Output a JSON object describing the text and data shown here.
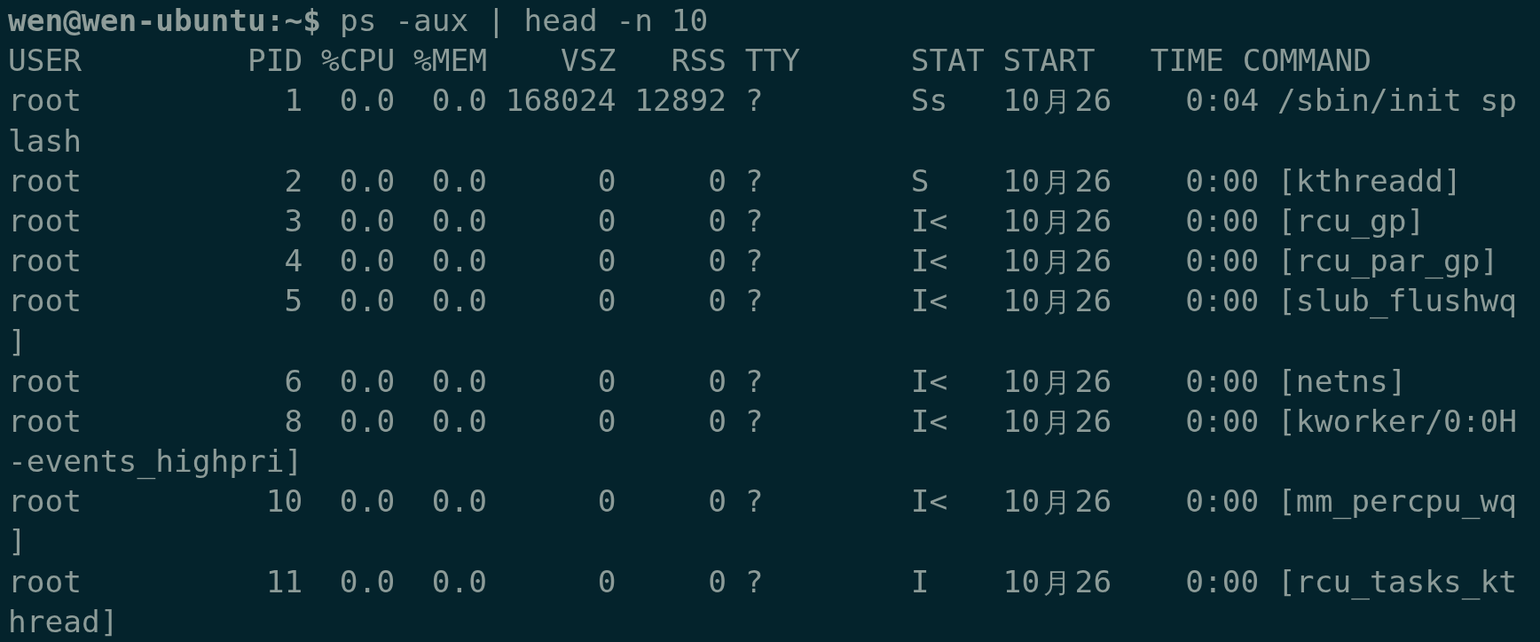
{
  "terminal": {
    "prompt": "wen@wen-ubuntu:~$",
    "command": "ps -aux | head -n 10",
    "output_lines": [
      "USER         PID %CPU %MEM    VSZ   RSS TTY      STAT START   TIME COMMAND",
      "root           1  0.0  0.0 168024 12892 ?        Ss   10月26    0:04 /sbin/init sp",
      "lash",
      "root           2  0.0  0.0      0     0 ?        S    10月26    0:00 [kthreadd]",
      "root           3  0.0  0.0      0     0 ?        I<   10月26    0:00 [rcu_gp]",
      "root           4  0.0  0.0      0     0 ?        I<   10月26    0:00 [rcu_par_gp]",
      "root           5  0.0  0.0      0     0 ?        I<   10月26    0:00 [slub_flushwq",
      "]",
      "root           6  0.0  0.0      0     0 ?        I<   10月26    0:00 [netns]",
      "root           8  0.0  0.0      0     0 ?        I<   10月26    0:00 [kworker/0:0H",
      "-events_highpri]",
      "root          10  0.0  0.0      0     0 ?        I<   10月26    0:00 [mm_percpu_wq",
      "]",
      "root          11  0.0  0.0      0     0 ?        I    10月26    0:00 [rcu_tasks_kt",
      "hread]"
    ]
  }
}
